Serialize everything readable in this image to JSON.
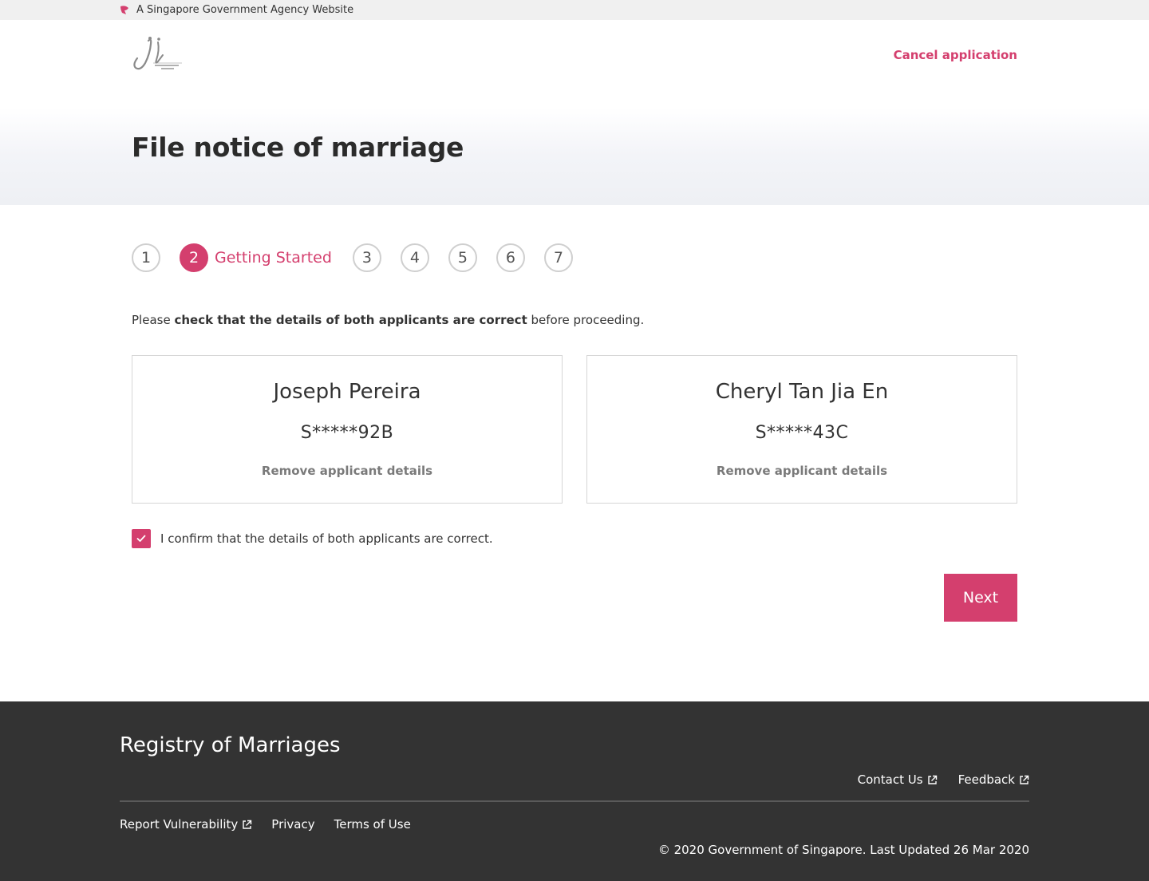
{
  "masthead": {
    "text": "A Singapore Government Agency Website",
    "icon": "lion-head-icon"
  },
  "header": {
    "logo_icon": "registry-of-marriages-logo-icon",
    "cancel_label": "Cancel application",
    "page_title": "File notice of marriage"
  },
  "stepper": {
    "steps": [
      "1",
      "2",
      "3",
      "4",
      "5",
      "6",
      "7"
    ],
    "active_step": "2",
    "active_label": "Getting Started"
  },
  "instruction": {
    "prefix": "Please ",
    "bold": "check that the details of both applicants are correct",
    "suffix": " before proceeding."
  },
  "applicants": [
    {
      "name": "Joseph Pereira",
      "id": "S*****92B",
      "remove_label": "Remove applicant details"
    },
    {
      "name": "Cheryl Tan Jia En",
      "id": "S*****43C",
      "remove_label": "Remove applicant details"
    }
  ],
  "confirm": {
    "checked": true,
    "label": "I confirm that the details of both applicants are correct."
  },
  "next_label": "Next",
  "footer": {
    "title": "Registry of Marriages",
    "contact_label": "Contact Us",
    "feedback_label": "Feedback",
    "report_label": "Report Vulnerability",
    "privacy_label": "Privacy",
    "terms_label": "Terms of Use",
    "copyright": "© 2020 Government of Singapore. Last Updated 26 Mar 2020"
  },
  "colors": {
    "accent": "#d43f6e",
    "footer_bg": "#333333",
    "masthead_bg": "#f0f0f0"
  }
}
